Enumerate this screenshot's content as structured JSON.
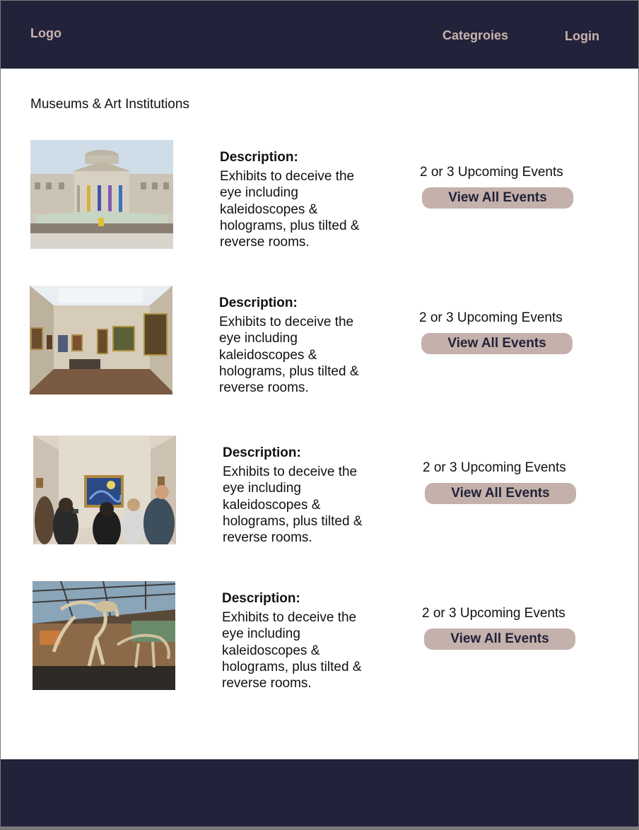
{
  "header": {
    "logo": "Logo",
    "nav": {
      "categories": "Categroies",
      "login": "Login"
    }
  },
  "main": {
    "section_title": "Museums & Art Institutions",
    "items": [
      {
        "description_label": "Description:",
        "description": "Exhibits to deceive the eye including kaleidoscopes & holograms, plus tilted & reverse rooms.",
        "events_text": "2 or 3 Upcoming Events",
        "button_label": "View All Events"
      },
      {
        "description_label": "Description:",
        "description": "Exhibits to deceive the eye including kaleidoscopes & holograms, plus tilted & reverse rooms.",
        "events_text": "2 or 3 Upcoming Events",
        "button_label": "View All Events"
      },
      {
        "description_label": "Description:",
        "description": "Exhibits to deceive the eye including kaleidoscopes & holograms, plus tilted & reverse rooms.",
        "events_text": "2 or 3 Upcoming Events",
        "button_label": "View All Events"
      },
      {
        "description_label": "Description:",
        "description": "Exhibits to deceive the eye including kaleidoscopes & holograms, plus tilted & reverse rooms.",
        "events_text": "2 or 3 Upcoming Events",
        "button_label": "View All Events"
      }
    ]
  },
  "colors": {
    "header_bg": "#22223a",
    "nav_text": "#c9b3ac",
    "button_bg": "#c4b1ab",
    "button_text": "#22223a"
  }
}
